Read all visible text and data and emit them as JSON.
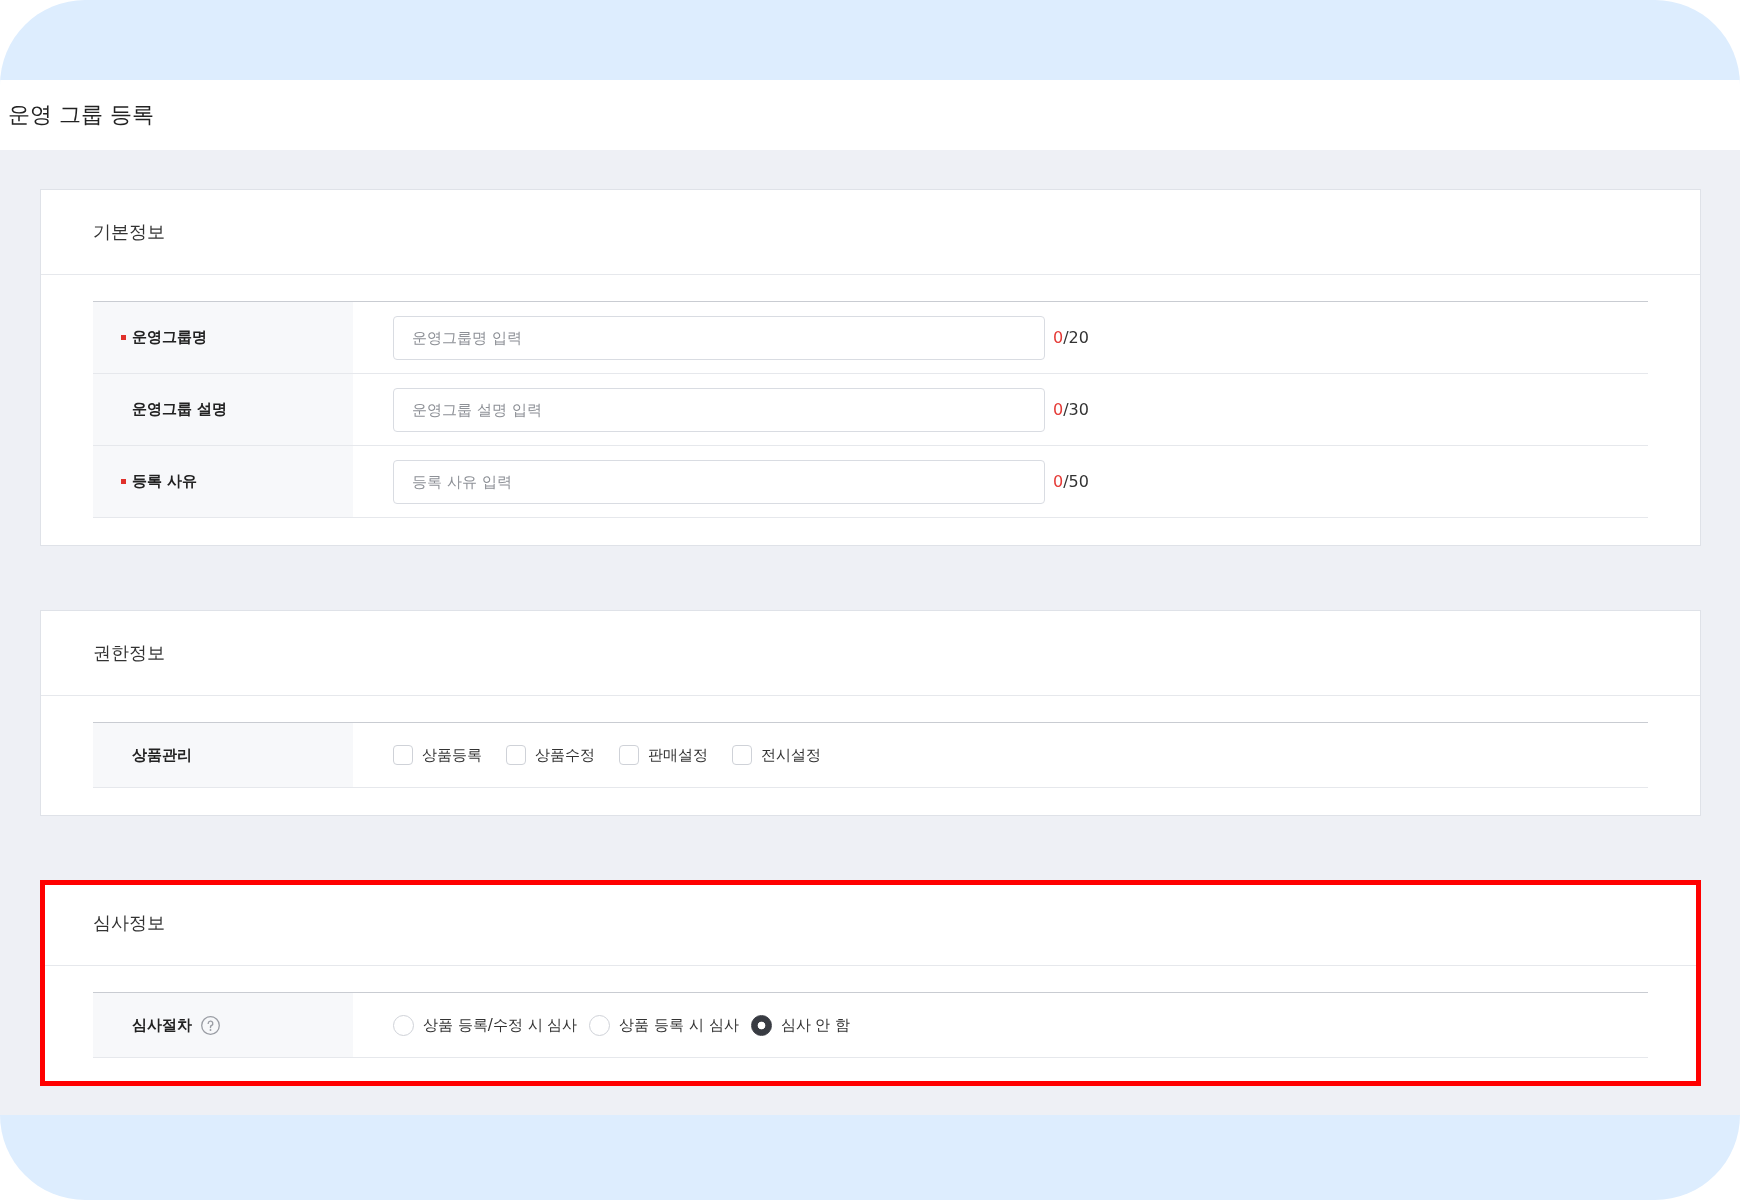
{
  "page": {
    "title": "운영 그룹 등록"
  },
  "sections": [
    {
      "title": "기본정보",
      "highlighted": false,
      "rows": [
        {
          "kind": "text_input",
          "label": "운영그룹명",
          "required": true,
          "help": false,
          "placeholder": "운영그룹명 입력",
          "count": "0",
          "limit": "/20"
        },
        {
          "kind": "text_input",
          "label": "운영그룹 설명",
          "required": false,
          "help": false,
          "placeholder": "운영그룹 설명 입력",
          "count": "0",
          "limit": "/30"
        },
        {
          "kind": "text_input",
          "label": "등록 사유",
          "required": true,
          "help": false,
          "placeholder": "등록 사유 입력",
          "count": "0",
          "limit": "/50"
        }
      ]
    },
    {
      "title": "권한정보",
      "highlighted": false,
      "rows": [
        {
          "kind": "checkboxes",
          "label": "상품관리",
          "required": false,
          "help": false,
          "options": [
            {
              "label": "상품등록",
              "checked": false
            },
            {
              "label": "상품수정",
              "checked": false
            },
            {
              "label": "판매설정",
              "checked": false
            },
            {
              "label": "전시설정",
              "checked": false
            }
          ]
        }
      ]
    },
    {
      "title": "심사정보",
      "highlighted": true,
      "rows": [
        {
          "kind": "radios",
          "label": "심사절차",
          "required": false,
          "help": true,
          "options": [
            {
              "label": "상품 등록/수정 시 심사",
              "selected": false
            },
            {
              "label": "상품 등록 시 심사",
              "selected": false
            },
            {
              "label": "심사 안 함",
              "selected": true
            }
          ]
        }
      ]
    }
  ]
}
